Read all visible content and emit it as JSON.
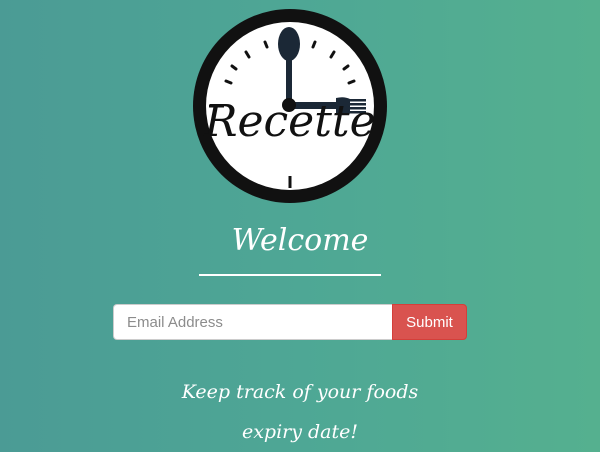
{
  "logo": {
    "brand_text": "Recette",
    "icon": "clock-with-spoon-and-fork-hands"
  },
  "welcome": {
    "heading": "Welcome"
  },
  "signup": {
    "email_placeholder": "Email Address",
    "email_value": "",
    "submit_label": "Submit"
  },
  "tagline": {
    "line1": "Keep track of your foods",
    "line2": "expiry date!"
  },
  "colors": {
    "background_start": "#4b9b95",
    "background_end": "#55b08f",
    "submit_button": "#d9534f",
    "text": "#ffffff"
  }
}
